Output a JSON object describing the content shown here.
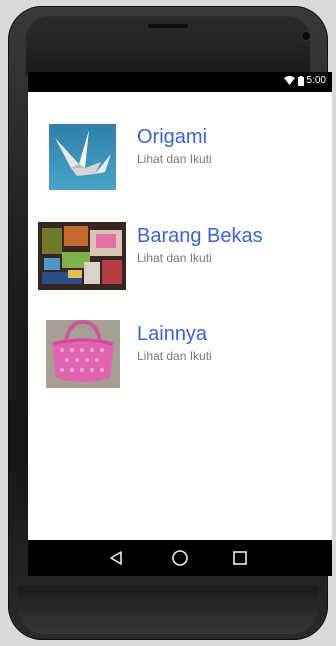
{
  "status_bar": {
    "time": "5:00"
  },
  "items": [
    {
      "title": "Origami",
      "subtitle": "Lihat dan Ikuti",
      "icon": "paper-crane-image"
    },
    {
      "title": "Barang Bekas",
      "subtitle": "Lihat dan Ikuti",
      "icon": "recycled-crafts-image"
    },
    {
      "title": "Lainnya",
      "subtitle": "Lihat dan Ikuti",
      "icon": "pink-bag-image"
    }
  ],
  "nav": {
    "back": "back-icon",
    "home": "home-icon",
    "recents": "recents-icon"
  },
  "colors": {
    "title": "#3d64c8",
    "subtitle": "#777777"
  }
}
